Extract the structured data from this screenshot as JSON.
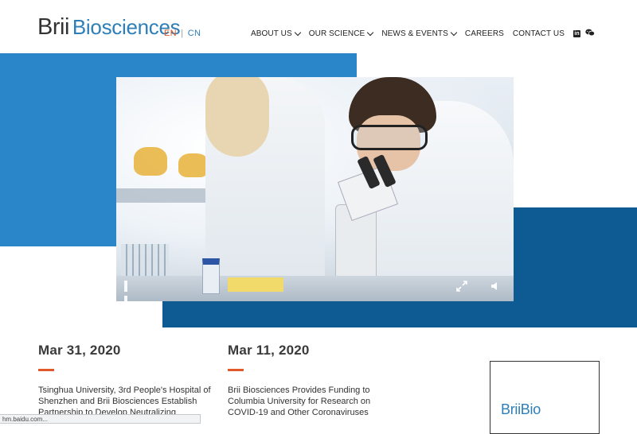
{
  "header": {
    "logo_brand": "Brii",
    "logo_name": "Biosciences",
    "lang_en": "EN",
    "lang_sep": "|",
    "lang_cn": "CN",
    "nav": [
      {
        "label": "ABOUT US",
        "has_dropdown": true
      },
      {
        "label": "OUR SCIENCE",
        "has_dropdown": true
      },
      {
        "label": "NEWS & EVENTS",
        "has_dropdown": true
      },
      {
        "label": "CAREERS",
        "has_dropdown": false
      },
      {
        "label": "CONTACT US",
        "has_dropdown": false
      }
    ],
    "social": {
      "linkedin": "in",
      "wechat_icon": "wechat-icon"
    }
  },
  "colors": {
    "brand_blue": "#2e7fb8",
    "hero_light_blue": "#2a86c9",
    "hero_dark_blue": "#0e5a92",
    "accent_orange": "#e0592a"
  },
  "news": [
    {
      "date": "Mar 31, 2020",
      "text": "Tsinghua University, 3rd People's Hospital of Shenzhen and Brii Biosciences Establish Partnership to Develop Neutralizing"
    },
    {
      "date": "Mar 11, 2020",
      "text": "Brii Biosciences Provides Funding to Columbia University for Research on COVID-19 and Other Coronaviruses"
    }
  ],
  "card": {
    "logo_text": "BriiBio"
  },
  "status": "hm.baidu.com..."
}
